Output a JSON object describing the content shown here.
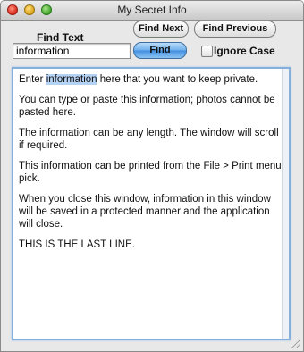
{
  "window": {
    "title": "My Secret Info"
  },
  "search": {
    "label": "Find Text",
    "value": "information"
  },
  "buttons": {
    "find_next": "Find Next",
    "find_previous": "Find Previous",
    "find": "Find"
  },
  "options": {
    "ignore_case_label": "Ignore Case",
    "ignore_case_checked": false
  },
  "content": {
    "line1_before": "Enter ",
    "line1_highlight": "information",
    "line1_after": " here that you want to keep private.",
    "paragraphs": [
      "You can type or paste this information; photos cannot be pasted here.",
      "The information can be any length.  The window will scroll if required.",
      "This information can be printed from the File > Print menu pick.",
      "When you close this window, information in this window will be saved in a protected manner and the application will close.",
      "THIS IS THE LAST LINE."
    ]
  },
  "colors": {
    "highlight": "#b4d2f3",
    "focus_ring": "#86b0dc",
    "default_button": "#3f8de0"
  }
}
